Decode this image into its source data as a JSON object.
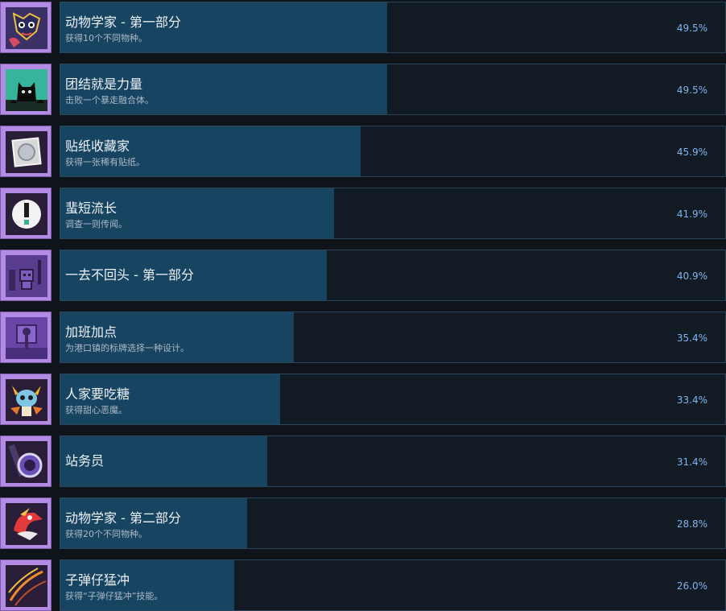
{
  "achievements": [
    {
      "title": "动物学家 - 第一部分",
      "desc": "获得10个不同物种。",
      "percent_label": "49.5%",
      "percent": 49.5,
      "icon": "creature-face-icon"
    },
    {
      "title": "团结就是力量",
      "desc": "击败一个暴走融合体。",
      "percent_label": "49.5%",
      "percent": 49.5,
      "icon": "black-cat-silhouette-icon"
    },
    {
      "title": "贴纸收藏家",
      "desc": "获得一张稀有贴纸。",
      "percent_label": "45.9%",
      "percent": 45.9,
      "icon": "sticker-icon"
    },
    {
      "title": "蜚短流长",
      "desc": "调查一则传闻。",
      "percent_label": "41.9%",
      "percent": 41.9,
      "icon": "exclamation-icon"
    },
    {
      "title": "一去不回头 - 第一部分",
      "desc": "",
      "percent_label": "40.9%",
      "percent": 40.9,
      "icon": "pixel-character-icon"
    },
    {
      "title": "加班加点",
      "desc": "为港口镇的标牌选择一种设计。",
      "percent_label": "35.4%",
      "percent": 35.4,
      "icon": "pixel-sign-icon"
    },
    {
      "title": "人家要吃糖",
      "desc": "获得甜心恶魔。",
      "percent_label": "33.4%",
      "percent": 33.4,
      "icon": "candy-devil-icon"
    },
    {
      "title": "站务员",
      "desc": "",
      "percent_label": "31.4%",
      "percent": 31.4,
      "icon": "portal-creature-icon"
    },
    {
      "title": "动物学家 - 第二部分",
      "desc": "获得20个不同物种。",
      "percent_label": "28.8%",
      "percent": 28.8,
      "icon": "bird-creature-icon"
    },
    {
      "title": "子弹仔猛冲",
      "desc": "获得“子弹仔猛冲”技能。",
      "percent_label": "26.0%",
      "percent": 26.0,
      "icon": "dash-trail-icon"
    }
  ],
  "colors": {
    "background": "#0f141b",
    "panel": "#121a24",
    "fill": "#164461",
    "percent_text": "#7fb6ee",
    "icon_frame": "#b48be4"
  }
}
